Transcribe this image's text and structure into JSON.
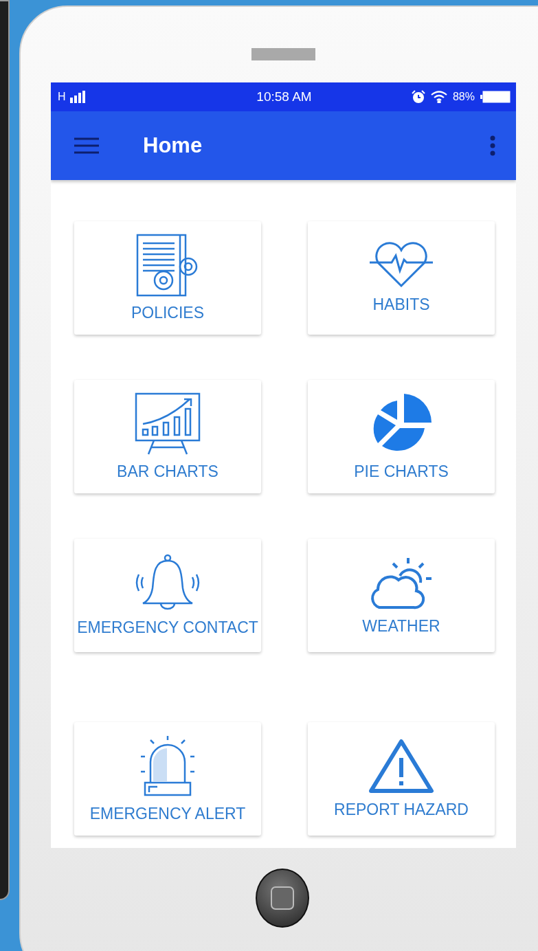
{
  "status_bar": {
    "network": "H",
    "time": "10:58 AM",
    "battery": "88%"
  },
  "toolbar": {
    "title": "Home"
  },
  "tiles": [
    {
      "label": "POLICIES"
    },
    {
      "label": "HABITS"
    },
    {
      "label": "BAR CHARTS"
    },
    {
      "label": "PIE CHARTS"
    },
    {
      "label": "EMERGENCY CONTACT"
    },
    {
      "label": "WEATHER"
    },
    {
      "label": "EMERGENCY ALERT"
    },
    {
      "label": "REPORT HAZARD"
    }
  ]
}
